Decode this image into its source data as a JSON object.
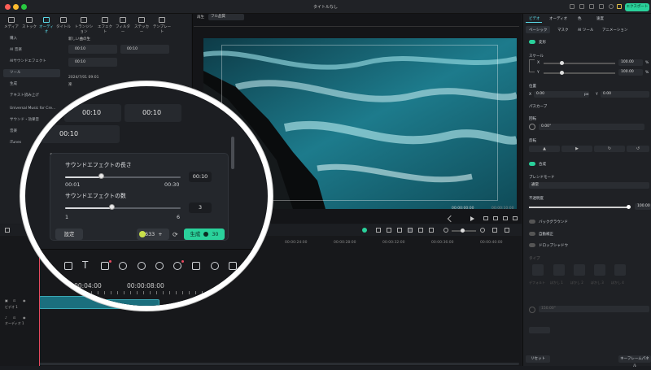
{
  "window": {
    "title": "タイトルなし",
    "export_label": "エクスポート"
  },
  "media_tabs": [
    {
      "label": "メディア",
      "icon": "media-icon"
    },
    {
      "label": "ストック",
      "icon": "stock-icon"
    },
    {
      "label": "オーディオ",
      "icon": "music-note-icon",
      "active": true
    },
    {
      "label": "タイトル",
      "icon": "title-icon"
    },
    {
      "label": "トランジション",
      "icon": "transition-icon"
    },
    {
      "label": "エフェクト",
      "icon": "effect-icon"
    },
    {
      "label": "フィルター",
      "icon": "filter-icon"
    },
    {
      "label": "ステッカー",
      "icon": "sticker-icon"
    },
    {
      "label": "テンプレート",
      "icon": "template-icon"
    }
  ],
  "sidebar": {
    "items": [
      {
        "label": "購入"
      },
      {
        "label": "AI 音楽"
      },
      {
        "label": "AIサウンドエフェクト"
      },
      {
        "label": "ツール",
        "active": true
      },
      {
        "label": "生成"
      },
      {
        "label": "テキスト読み上げ"
      },
      {
        "label": "Universal Music for Cre..."
      },
      {
        "label": "サウンド・効果音"
      },
      {
        "label": "音楽"
      },
      {
        "label": "iTunes"
      }
    ]
  },
  "assets": {
    "heading": "新しい曲の生",
    "date": "2024/7/01 09:01",
    "duration": "00:10",
    "card_durations": [
      "00:10",
      "00:10",
      "00:10",
      "00:10"
    ],
    "row_label": "楽"
  },
  "preview": {
    "player_label": "再生",
    "quality": "フル品質",
    "time_current": "00:00:00:00",
    "time_total": "00:00:10:00",
    "ruler_ticks": [
      "0",
      "100",
      "200",
      "300",
      "400",
      "500",
      "600",
      "700",
      "800"
    ]
  },
  "properties": {
    "tabs": [
      "ビデオ",
      "オーディオ",
      "色",
      "速度"
    ],
    "active_tab": "ビデオ",
    "subtabs": [
      "ベーシック",
      "マスク",
      "AI ツール",
      "アニメーション"
    ],
    "sections": {
      "transform": "変形",
      "scale": "スケール",
      "scale_x": "100.00",
      "scale_y": "100.00",
      "scale_unit": "%",
      "position": "位置",
      "pos_x": "0.00",
      "pos_y": "0.00",
      "pos_unit": "px",
      "path_curve": "パスカーブ",
      "rotate": "回転",
      "rotate_value": "0.00°",
      "flip": "反転",
      "composite": "合成",
      "blend_mode": "ブレンドモード",
      "blend_value": "通常",
      "opacity": "不透明度",
      "opacity_value": "100.00",
      "background": "バックグラウンド",
      "auto_enhance": "自動補正",
      "drop_shadow": "ドロップシャドウ",
      "type": "タイプ",
      "shadow_types": [
        "デフォルト",
        "ぼかし 1",
        "ぼかし 2",
        "ぼかし 3",
        "ぼかし 4"
      ],
      "distance_value": "150.00°",
      "reset": "リセット",
      "keyframe": "キーフレームパネル"
    }
  },
  "timeline": {
    "ruler": [
      "00:00:04:00",
      "00:00:08:00",
      "00:00:12:00",
      "00:00:16:00",
      "00:00:20:00",
      "00:00:24:00",
      "00:00:28:00",
      "00:00:32:00",
      "00:00:36:00",
      "00:00:40:00"
    ],
    "tracks": [
      {
        "label": "ビデオ 1"
      },
      {
        "label": "オーディオ 1"
      }
    ]
  },
  "loupe": {
    "cards_top": [
      "00:10",
      "00:10",
      "00:10"
    ],
    "year_partial": "20",
    "char_partial": "沢",
    "dialog": {
      "length_label": "サウンドエフェクトの長さ",
      "length_min": "00:01",
      "length_max": "00:30",
      "length_value": "00:10",
      "length_level": 0.31,
      "count_label": "サウンドエフェクトの数",
      "count_min": "1",
      "count_max": "6",
      "count_value": "3",
      "count_level": 0.4,
      "settings_button": "設定",
      "credits": "633",
      "generate_button": "生成",
      "generate_cost": "30"
    },
    "timeline_ticks": [
      "00:00:04:00",
      "00:00:08:00"
    ],
    "toolbar_icons": [
      "crop-icon",
      "text-icon",
      "shape-icon",
      "mask-icon",
      "speed-icon",
      "color-icon",
      "ai-icon",
      "sticker-icon",
      "timer-icon",
      "more-icon"
    ]
  },
  "colors": {
    "accent": "#2ad19b",
    "active_tab": "#5ad9e8",
    "playhead": "#e84a5f",
    "clip": "#1b6f7e"
  }
}
